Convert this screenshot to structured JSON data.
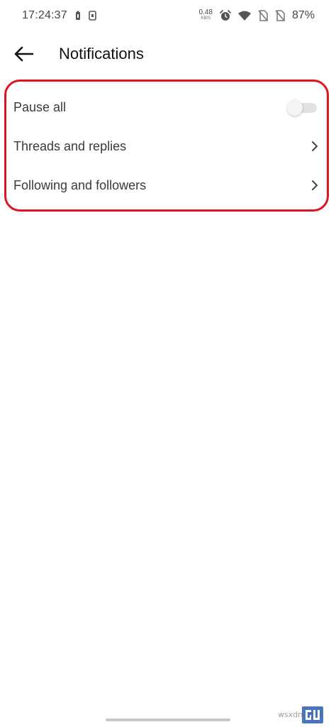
{
  "status_bar": {
    "time": "17:24:37",
    "net_speed_value": "0.48",
    "net_speed_unit": "KB/S",
    "battery_percent": "87%",
    "icons": [
      "battery-saver-icon",
      "screen-record-icon",
      "alarm-icon",
      "wifi-icon",
      "no-sim-icon",
      "no-sim-icon"
    ]
  },
  "header": {
    "title": "Notifications",
    "back_icon": "arrow-left-icon"
  },
  "settings": {
    "items": [
      {
        "label": "Pause all",
        "control": "toggle",
        "toggle_on": false
      },
      {
        "label": "Threads and replies",
        "control": "chevron"
      },
      {
        "label": "Following and followers",
        "control": "chevron"
      }
    ]
  },
  "highlight_color": "#e0141e",
  "watermark": {
    "text": "wsxdn.com",
    "logo_icon": "gadgets-logo-icon"
  }
}
